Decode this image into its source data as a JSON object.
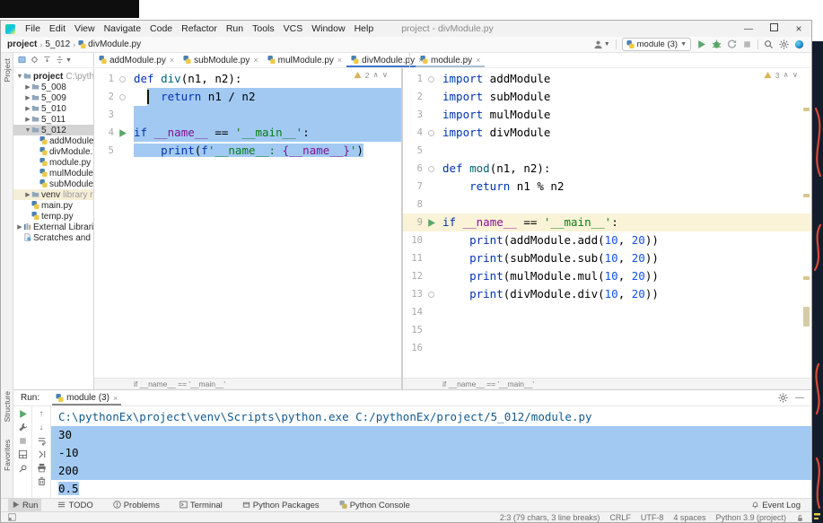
{
  "window": {
    "title": "project - divModule.py"
  },
  "menu": {
    "items": [
      "File",
      "Edit",
      "View",
      "Navigate",
      "Code",
      "Refactor",
      "Run",
      "Tools",
      "VCS",
      "Window",
      "Help"
    ]
  },
  "breadcrumb": {
    "items": [
      "project",
      "5_012",
      "divModule.py"
    ]
  },
  "main_toolbar": {
    "run_config": "module (3)",
    "icons": [
      "user",
      "separator",
      "run-config",
      "run",
      "debug",
      "coverage",
      "stop",
      "separator",
      "search",
      "settings",
      "code-with-me"
    ]
  },
  "side_labels": {
    "top": "Project",
    "bottom": [
      "Structure",
      "Favorites"
    ]
  },
  "project_panel": {
    "toolbar_icons": [
      "project-view",
      "locate-file",
      "expand-all",
      "collapse-all"
    ],
    "tree": [
      {
        "depth": 0,
        "arrow": "v",
        "icon": "folder",
        "label": "project",
        "extra": "C:\\pythonEx",
        "bold": true
      },
      {
        "depth": 1,
        "arrow": ">",
        "icon": "folder",
        "label": "5_008"
      },
      {
        "depth": 1,
        "arrow": ">",
        "icon": "folder",
        "label": "5_009"
      },
      {
        "depth": 1,
        "arrow": ">",
        "icon": "folder",
        "label": "5_010"
      },
      {
        "depth": 1,
        "arrow": ">",
        "icon": "folder",
        "label": "5_011"
      },
      {
        "depth": 1,
        "arrow": "v",
        "icon": "folder",
        "label": "5_012",
        "selected": true
      },
      {
        "depth": 2,
        "icon": "py",
        "label": "addModule.py"
      },
      {
        "depth": 2,
        "icon": "py",
        "label": "divModule.py"
      },
      {
        "depth": 2,
        "icon": "py",
        "label": "module.py"
      },
      {
        "depth": 2,
        "icon": "py",
        "label": "mulModule.py"
      },
      {
        "depth": 2,
        "icon": "py",
        "label": "subModule.py"
      },
      {
        "depth": 1,
        "arrow": ">",
        "icon": "folder",
        "label": "venv",
        "extra": "library root",
        "highlight": true
      },
      {
        "depth": 1,
        "icon": "py",
        "label": "main.py"
      },
      {
        "depth": 1,
        "icon": "py",
        "label": "temp.py"
      },
      {
        "depth": 0,
        "arrow": ">",
        "icon": "lib",
        "label": "External Libraries"
      },
      {
        "depth": 0,
        "icon": "scratch",
        "label": "Scratches and Cons"
      }
    ]
  },
  "editor_tabs": {
    "left": [
      {
        "label": "addModule.py"
      },
      {
        "label": "subModule.py"
      },
      {
        "label": "mulModule.py"
      },
      {
        "label": "divModule.py",
        "active": true
      }
    ],
    "right": [
      {
        "label": "module.py",
        "active_dim": true
      }
    ]
  },
  "editors": {
    "left": {
      "warnings": "2",
      "breadcrumb": "if __name__ == '__main__'",
      "sel_start_col": 3,
      "lines": [
        {
          "n": 1,
          "fold": true,
          "tokens": [
            [
              "def",
              "kw"
            ],
            [
              " ",
              "pl"
            ],
            [
              "div",
              "fn"
            ],
            [
              "(n1, n2):",
              "pl"
            ]
          ]
        },
        {
          "n": 2,
          "fold": true,
          "sel": "caret-full",
          "tokens": [
            [
              "    ",
              "pl"
            ],
            [
              "return",
              "kw"
            ],
            [
              " n1 / n2",
              "pl"
            ]
          ]
        },
        {
          "n": 3,
          "sel": "full",
          "tokens": []
        },
        {
          "n": 4,
          "run": true,
          "sel": "full",
          "tokens": [
            [
              "if",
              "kw"
            ],
            [
              " ",
              "pl"
            ],
            [
              "__name__",
              "dund"
            ],
            [
              " == ",
              "pl"
            ],
            [
              "'__main__'",
              "str"
            ],
            [
              ":",
              "pl"
            ]
          ]
        },
        {
          "n": 5,
          "sel": "text",
          "tokens": [
            [
              "    ",
              "pl"
            ],
            [
              "print",
              "kw"
            ],
            [
              "(",
              "pl"
            ],
            [
              "f",
              "kw"
            ],
            [
              "'__name__: ",
              "str"
            ],
            [
              "{__name__}",
              "dund"
            ],
            [
              "'",
              "str"
            ],
            [
              ")",
              "pl"
            ]
          ]
        }
      ]
    },
    "right": {
      "warnings": "3",
      "breadcrumb": "if __name__ == '__main__'",
      "lines": [
        {
          "n": 1,
          "fold": true,
          "tokens": [
            [
              "import",
              "kw"
            ],
            [
              " addModule",
              "pl"
            ]
          ]
        },
        {
          "n": 2,
          "tokens": [
            [
              "import",
              "kw"
            ],
            [
              " subModule",
              "pl"
            ]
          ]
        },
        {
          "n": 3,
          "tokens": [
            [
              "import",
              "kw"
            ],
            [
              " mulModule",
              "pl"
            ]
          ]
        },
        {
          "n": 4,
          "fold": true,
          "tokens": [
            [
              "import",
              "kw"
            ],
            [
              " divModule",
              "pl"
            ]
          ]
        },
        {
          "n": 5,
          "tokens": []
        },
        {
          "n": 6,
          "fold": true,
          "tokens": [
            [
              "def",
              "kw"
            ],
            [
              " ",
              "pl"
            ],
            [
              "mod",
              "fn"
            ],
            [
              "(n1, n2):",
              "pl"
            ]
          ]
        },
        {
          "n": 7,
          "tokens": [
            [
              "    ",
              "pl"
            ],
            [
              "return",
              "kw"
            ],
            [
              " n1 % n2",
              "pl"
            ]
          ]
        },
        {
          "n": 8,
          "tokens": []
        },
        {
          "n": 9,
          "run": true,
          "current": true,
          "fold": true,
          "tokens": [
            [
              "if",
              "kw"
            ],
            [
              " ",
              "pl"
            ],
            [
              "__name__",
              "dund"
            ],
            [
              " == ",
              "pl"
            ],
            [
              "'__main__'",
              "str"
            ],
            [
              ":",
              "pl"
            ]
          ]
        },
        {
          "n": 10,
          "tokens": [
            [
              "    ",
              "pl"
            ],
            [
              "print",
              "kw"
            ],
            [
              "(addModule.add(",
              "pl"
            ],
            [
              "10",
              "num"
            ],
            [
              ", ",
              "pl"
            ],
            [
              "20",
              "num"
            ],
            [
              "))",
              "pl"
            ]
          ]
        },
        {
          "n": 11,
          "tokens": [
            [
              "    ",
              "pl"
            ],
            [
              "print",
              "kw"
            ],
            [
              "(subModule.sub(",
              "pl"
            ],
            [
              "10",
              "num"
            ],
            [
              ", ",
              "pl"
            ],
            [
              "20",
              "num"
            ],
            [
              "))",
              "pl"
            ]
          ]
        },
        {
          "n": 12,
          "tokens": [
            [
              "    ",
              "pl"
            ],
            [
              "print",
              "kw"
            ],
            [
              "(mulModule.mul(",
              "pl"
            ],
            [
              "10",
              "num"
            ],
            [
              ", ",
              "pl"
            ],
            [
              "20",
              "num"
            ],
            [
              "))",
              "pl"
            ]
          ]
        },
        {
          "n": 13,
          "fold": true,
          "tokens": [
            [
              "    ",
              "pl"
            ],
            [
              "print",
              "kw"
            ],
            [
              "(divModule.div(",
              "pl"
            ],
            [
              "10",
              "num"
            ],
            [
              ", ",
              "pl"
            ],
            [
              "20",
              "num"
            ],
            [
              "))",
              "pl"
            ]
          ]
        },
        {
          "n": 14,
          "tokens": []
        },
        {
          "n": 15,
          "tokens": []
        },
        {
          "n": 16,
          "tokens": []
        }
      ]
    }
  },
  "run_panel": {
    "label": "Run:",
    "tab": "module (3)",
    "toolbar_main": [
      "rerun",
      "settings",
      "stop",
      "restore-layout",
      "pin"
    ],
    "toolbar_console": [
      "up",
      "down",
      "soft-wrap",
      "scroll-end",
      "print",
      "clear"
    ],
    "console": [
      {
        "text": "C:\\pythonEx\\project\\venv\\Scripts\\python.exe C:/pythonEx/project/5_012/module.py",
        "cmd": true
      },
      {
        "text": "30",
        "sel": "full"
      },
      {
        "text": "-10",
        "sel": "full"
      },
      {
        "text": "200",
        "sel": "full"
      },
      {
        "text": "0.5",
        "sel": "text"
      }
    ]
  },
  "tool_window_bar": {
    "left": [
      {
        "label": "Run",
        "icon": "play-small",
        "active": true
      },
      {
        "label": "TODO",
        "icon": "todo"
      },
      {
        "label": "Problems",
        "icon": "problems"
      },
      {
        "label": "Terminal",
        "icon": "terminal"
      },
      {
        "label": "Python Packages",
        "icon": "package"
      },
      {
        "label": "Python Console",
        "icon": "pyconsole"
      }
    ],
    "right": [
      {
        "label": "Event Log",
        "icon": "bell"
      }
    ]
  },
  "status_bar": {
    "items": [
      "2:3 (79 chars, 3 line breaks)",
      "CRLF",
      "UTF-8",
      "4 spaces",
      "Python 3.9 (project)"
    ]
  },
  "colors": {
    "selection": "#a2c9f2",
    "current_line": "#fbf3d7",
    "tab_accent": "#3a78c9",
    "keyword": "#0033B3",
    "string": "#067D17",
    "number": "#1750EB",
    "function": "#00627A",
    "dunder": "#871094",
    "run_green": "#59A869",
    "console_cmd": "#135a8e"
  }
}
